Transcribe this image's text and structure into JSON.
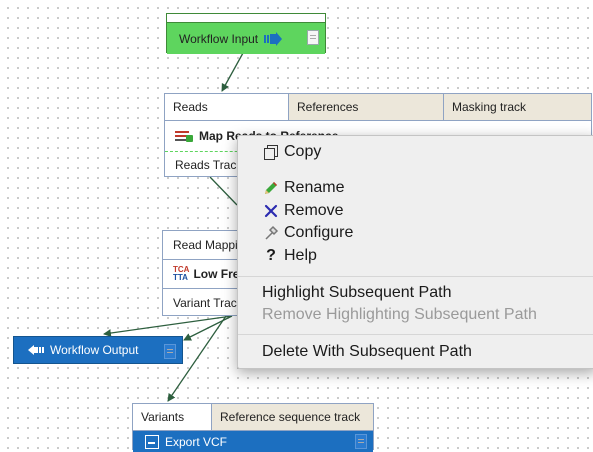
{
  "workflow_input": {
    "label": "Workflow Input"
  },
  "map_reads": {
    "ports": [
      "Reads",
      "References",
      "Masking track"
    ],
    "title": "Map Reads to Reference",
    "output": "Reads Track"
  },
  "low_frequency": {
    "input": "Read Mapping",
    "title": "Low Frequency Variant Detection",
    "output": "Variant Track",
    "icon_text": "TCA TTA"
  },
  "workflow_output": {
    "label": "Workflow Output"
  },
  "export_vcf": {
    "ports": [
      "Variants",
      "Reference sequence track"
    ],
    "title": "Export VCF"
  },
  "context_menu": {
    "items": [
      {
        "label": "Copy",
        "icon": "copy-icon"
      },
      {
        "label": "Rename",
        "icon": "pencil-icon"
      },
      {
        "label": "Remove",
        "icon": "x-icon"
      },
      {
        "label": "Configure",
        "icon": "wrench-icon"
      },
      {
        "label": "Help",
        "icon": "question-icon",
        "glyph": "?"
      },
      {
        "label": "Highlight Subsequent Path"
      },
      {
        "label": "Remove Highlighting Subsequent Path",
        "disabled": true
      },
      {
        "label": "Delete With Subsequent Path"
      }
    ]
  },
  "colors": {
    "input_green": "#5ed55e",
    "output_blue": "#1c6fc0",
    "port_tan": "#ece7da",
    "remove_x": "#2b2bb0",
    "pencil_green": "#3aa83a"
  }
}
